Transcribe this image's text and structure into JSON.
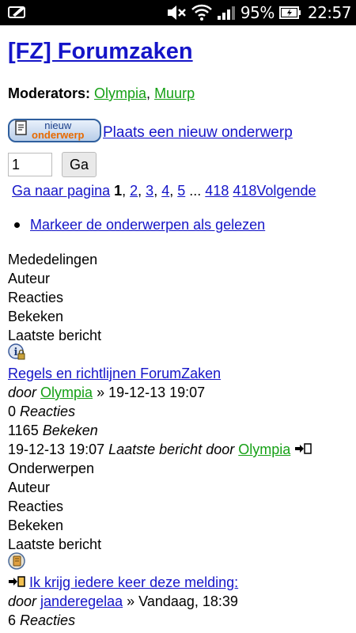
{
  "statusbar": {
    "battery": "95%",
    "time": "22:57"
  },
  "forum": {
    "title": "[FZ] Forumzaken",
    "moderators_label": "Moderators:",
    "moderators": [
      "Olympia",
      "Muurp"
    ],
    "separator": ", "
  },
  "new_topic": {
    "button_line1": "nieuw",
    "button_line2": "onderwerp",
    "link": "Plaats een nieuw onderwerp"
  },
  "page_jump": {
    "value": "1",
    "go_label": "Ga"
  },
  "pagination": {
    "label": "Ga naar pagina",
    "current": "1",
    "pages": [
      "2",
      "3",
      "4",
      "5"
    ],
    "ellipsis": "...",
    "last": "418",
    "next": "418Volgende"
  },
  "mark_read": "Markeer de onderwerpen als gelezen",
  "announcements": {
    "headers": [
      "Mededelingen",
      "Auteur",
      "Reacties",
      "Bekeken",
      "Laatste bericht"
    ],
    "topic": {
      "title": "Regels en richtlijnen ForumZaken",
      "by": "door",
      "author": "Olympia",
      "date": " » 19-12-13 19:07",
      "replies_count": "0",
      "replies_label": "Reacties",
      "views_count": "1165",
      "views_label": "Bekeken",
      "last_date": "19-12-13 19:07",
      "last_label": "Laatste bericht door",
      "last_user": "Olympia"
    }
  },
  "topics": {
    "headers": [
      "Onderwerpen",
      "Auteur",
      "Reacties",
      "Bekeken",
      "Laatste bericht"
    ],
    "topic": {
      "title": " Ik krijg iedere keer deze melding:",
      "by": "door",
      "author": "janderegelaa",
      "date": " » Vandaag, 18:39",
      "replies_count": "6",
      "replies_label": "Reacties"
    }
  }
}
